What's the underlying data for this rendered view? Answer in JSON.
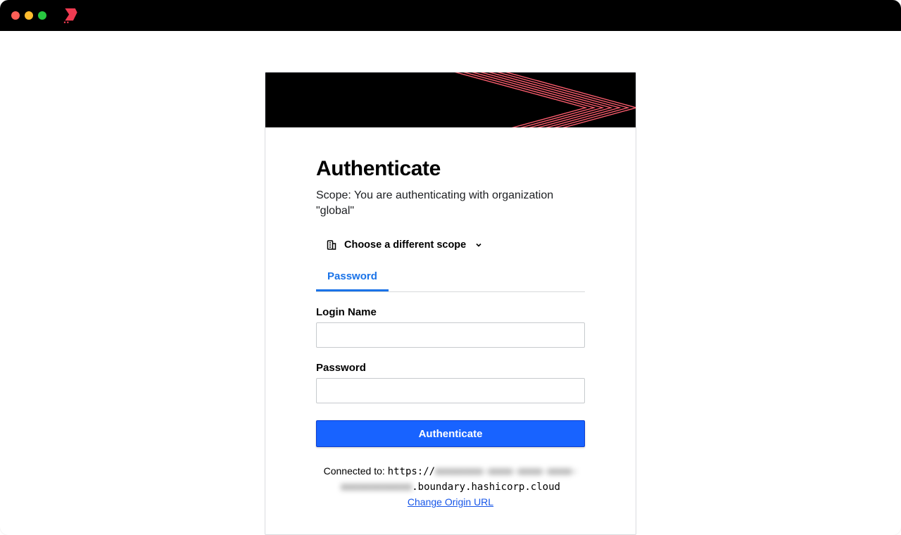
{
  "titlebar": {
    "traffic": {
      "close": "close",
      "min": "minimize",
      "full": "fullscreen"
    }
  },
  "auth": {
    "heading": "Authenticate",
    "scope_text": "Scope: You are authenticating with organization \"global\"",
    "scope_picker_label": "Choose a different scope",
    "tabs": {
      "password": "Password"
    },
    "fields": {
      "login_label": "Login Name",
      "login_value": "",
      "password_label": "Password",
      "password_value": ""
    },
    "submit_label": "Authenticate",
    "connected_prefix": "Connected to: ",
    "connected_scheme": "https://",
    "connected_host_blur1": "xxxxxxxx-xxxx-xxxx-xxxx-",
    "connected_host_blur2": "xxxxxxxxxxxx",
    "connected_host_suffix": ".boundary.hashicorp.cloud",
    "change_origin_label": "Change Origin URL"
  }
}
